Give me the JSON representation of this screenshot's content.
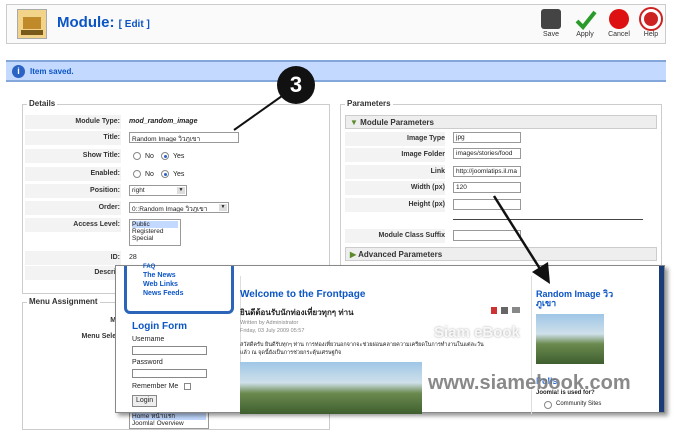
{
  "header": {
    "title": "Module:",
    "subtitle": "[ Edit ]",
    "buttons": [
      {
        "label": "Save",
        "icon": "save-icon"
      },
      {
        "label": "Apply",
        "icon": "check-icon"
      },
      {
        "label": "Cancel",
        "icon": "cancel-icon"
      },
      {
        "label": "Help",
        "icon": "help-icon"
      }
    ]
  },
  "message": {
    "text": "Item saved."
  },
  "details": {
    "legend": "Details",
    "module_type_label": "Module Type:",
    "module_type_value": "mod_random_image",
    "title_label": "Title:",
    "title_value": "Random Image วิวภูเขา",
    "show_title_label": "Show Title:",
    "enabled_label": "Enabled:",
    "no": "No",
    "yes": "Yes",
    "position_label": "Position:",
    "position_value": "right",
    "order_label": "Order:",
    "order_value": "0::Random Image วิวภูเขา",
    "access_label": "Access Level:",
    "access_options": [
      "Public",
      "Registered",
      "Special"
    ],
    "id_label": "ID:",
    "id_value": "28",
    "description_label": "Descrip"
  },
  "menu_assignment": {
    "legend": "Menu Assignment",
    "menus_label": "Me",
    "menu_selection_label": "Menu Selec",
    "list_items": [
      "Home หน้าแรก",
      "Joomla! Overview"
    ]
  },
  "parameters": {
    "legend": "Parameters",
    "module_params": "Module Parameters",
    "image_type_label": "Image Type",
    "image_type_value": "jpg",
    "image_folder_label": "Image Folder",
    "image_folder_value": "images/stories/food",
    "link_label": "Link",
    "link_value": "http://joomlatips.il.ma",
    "width_label": "Width (px)",
    "width_value": "120",
    "height_label": "Height (px)",
    "height_value": "",
    "class_suffix_label": "Module Class Suffix",
    "advanced_params": "Advanced Parameters"
  },
  "frontpage": {
    "nav_items": [
      "FAQ",
      "The News",
      "Web Links",
      "News Feeds"
    ],
    "login_title": "Login Form",
    "username_label": "Username",
    "password_label": "Password",
    "remember_label": "Remember Me",
    "login_button": "Login",
    "welcome_title": "Welcome to the Frontpage",
    "article_title": "ยินดีต้อนรับนักท่องเที่ยวทุกๆ ท่าน",
    "article_author": "Written by Administrator",
    "article_date": "Friday, 03 July 2009 05:57",
    "article_body_1": "สวัสดีครับ ยินดีรับทุกๆ ท่าน การท่องเที่ยวนอกจากจะช่วยผ่อนคลายความเครียดในการทำงานในแต่ละวัน",
    "article_body_2": "แล้ว ณ จุดนี้ยังเป็นการช่วยกระตุ้นเศรษฐกิจ",
    "random_image_title": "Random Image วิว ภูเขา",
    "polls_title": "Polls",
    "poll_question": "Joomla! is used for?",
    "poll_option": "Community Sites",
    "watermark_1": "Siam eBook",
    "watermark_2": "www.siamebook.com"
  },
  "callout": {
    "number": "3"
  }
}
